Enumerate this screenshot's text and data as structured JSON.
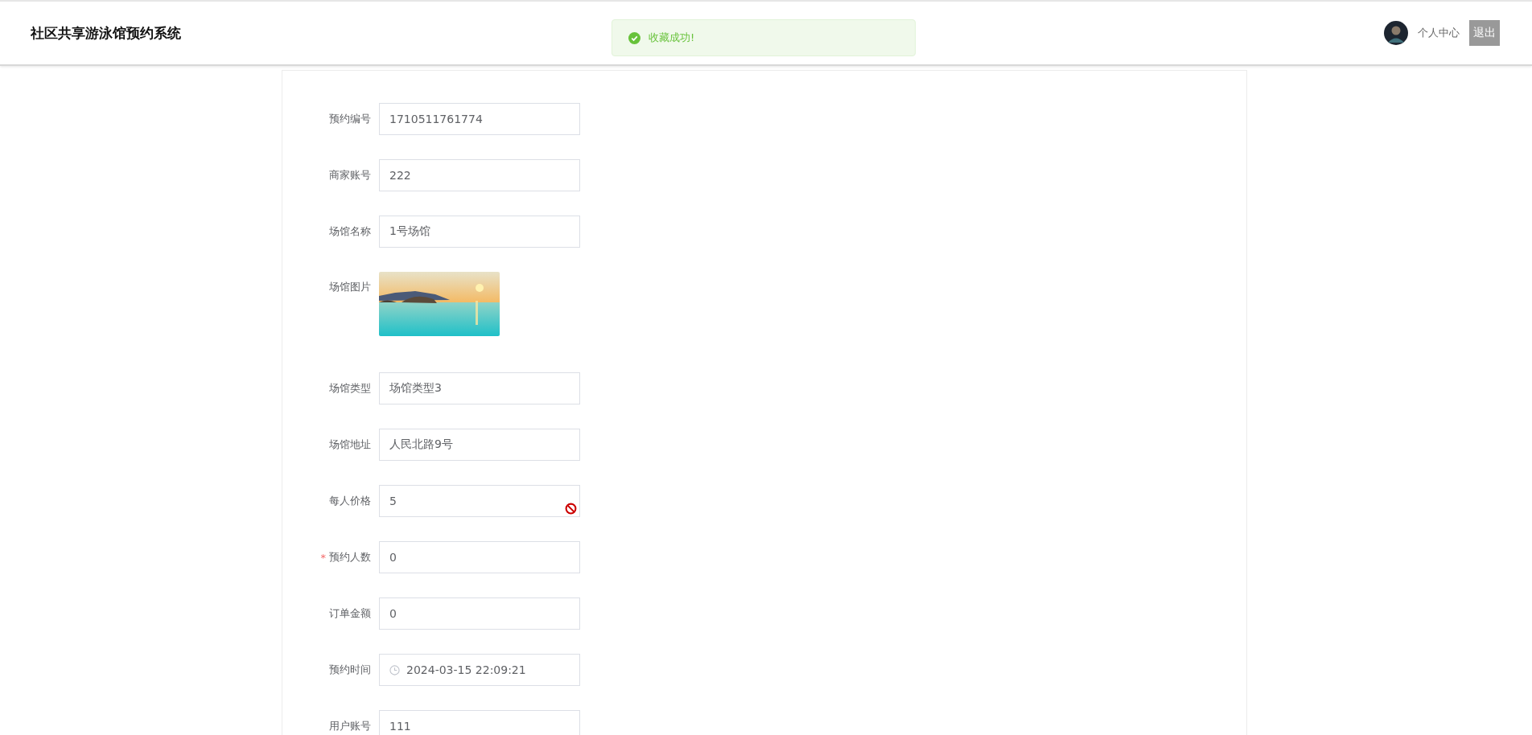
{
  "header": {
    "title": "社区共享游泳馆预约系统",
    "user_link": "个人中心",
    "logout": "退出"
  },
  "toast": {
    "message": "收藏成功!"
  },
  "form": {
    "fields": [
      {
        "kind": "text",
        "label": "预约编号",
        "value": "1710511761774",
        "invalid": false
      },
      {
        "kind": "text",
        "label": "商家账号",
        "value": "222",
        "invalid": false
      },
      {
        "kind": "text",
        "label": "场馆名称",
        "value": "1号场馆",
        "invalid": false
      },
      {
        "label": "场馆图片",
        "invalid": false
      },
      {
        "kind": "text",
        "label": "场馆类型",
        "value": "场馆类型3",
        "invalid": false
      },
      {
        "kind": "text",
        "label": "场馆地址",
        "value": "人民北路9号",
        "invalid": false
      },
      {
        "kind": "text",
        "label": "每人价格",
        "value": "5",
        "invalid": true
      },
      {
        "kind": "text",
        "label": "预约人数",
        "value": "0",
        "required_mark": "*",
        "invalid": false
      },
      {
        "kind": "text",
        "label": "订单金额",
        "value": "0",
        "invalid": false
      },
      {
        "kind": "datetime",
        "label": "预约时间",
        "value": "2024-03-15 22:09:21",
        "invalid": false
      },
      {
        "kind": "text",
        "label": "用户账号",
        "value": "111",
        "invalid": false
      }
    ]
  }
}
